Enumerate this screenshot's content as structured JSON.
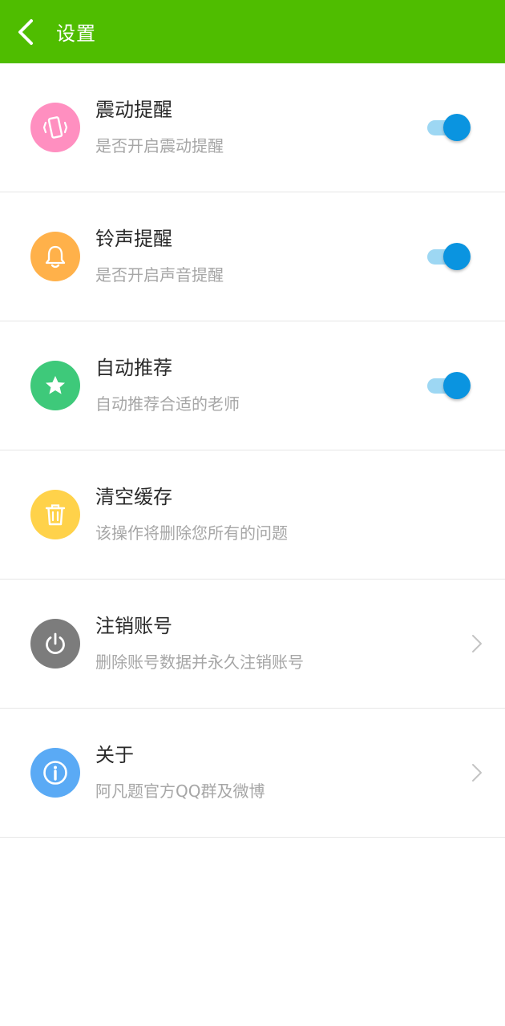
{
  "header": {
    "title": "设置",
    "back_icon": "chevron-left-icon"
  },
  "colors": {
    "accent": "#4fbd00",
    "toggle_on_thumb": "#0a94e0",
    "toggle_on_track": "#9dd7f3"
  },
  "settings": [
    {
      "title": "震动提醒",
      "subtitle": "是否开启震动提醒",
      "icon": "vibration-icon",
      "icon_color": "#ff8fc0",
      "control": "toggle",
      "on": true
    },
    {
      "title": "铃声提醒",
      "subtitle": "是否开启声音提醒",
      "icon": "bell-icon",
      "icon_color": "#ffb14a",
      "control": "toggle",
      "on": true
    },
    {
      "title": "自动推荐",
      "subtitle": "自动推荐合适的老师",
      "icon": "star-icon",
      "icon_color": "#3ec97a",
      "control": "toggle",
      "on": true
    },
    {
      "title": "清空缓存",
      "subtitle": "该操作将删除您所有的问题",
      "icon": "trash-icon",
      "icon_color": "#ffd24a",
      "control": "none"
    },
    {
      "title": "注销账号",
      "subtitle": "删除账号数据并永久注销账号",
      "icon": "power-icon",
      "icon_color": "#7c7c7c",
      "control": "chevron"
    },
    {
      "title": "关于",
      "subtitle": "阿凡题官方QQ群及微博",
      "icon": "info-icon",
      "icon_color": "#5aaaf5",
      "control": "chevron"
    }
  ]
}
